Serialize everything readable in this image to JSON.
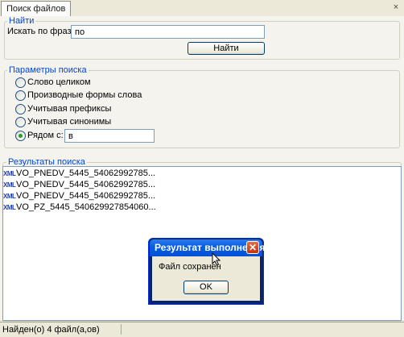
{
  "window": {
    "tab_title": "Поиск файлов",
    "tab_close": "×"
  },
  "find_group": {
    "legend": "Найти",
    "search_label": "Искать по фразе:",
    "search_value": "по",
    "find_button": "Найти"
  },
  "params_group": {
    "legend": "Параметры поиска",
    "options": [
      {
        "label": "Слово целиком",
        "selected": false
      },
      {
        "label": "Производные формы слова",
        "selected": false
      },
      {
        "label": "Учитывая префиксы",
        "selected": false
      },
      {
        "label": "Учитывая синонимы",
        "selected": false
      },
      {
        "label": "Рядом с:",
        "selected": true
      }
    ],
    "near_value": "в"
  },
  "results_group": {
    "legend": "Результаты поиска",
    "icon": "XML",
    "items": [
      "VO_PNEDV_5445_54062992785...",
      "VO_PNEDV_5445_54062992785...",
      "VO_PNEDV_5445_54062992785...",
      "VO_PZ_5445_540629927854060..."
    ]
  },
  "status_bar": {
    "text": "Найден(о) 4 файл(а,ов)"
  },
  "dialog": {
    "title": "Результат выполнения",
    "close": "✕",
    "message": "Файл сохранен",
    "ok_button": "OK"
  },
  "colors": {
    "legend": "#0046d5",
    "dialog_title": "#0450d8",
    "radio_selected": "#21a121"
  }
}
